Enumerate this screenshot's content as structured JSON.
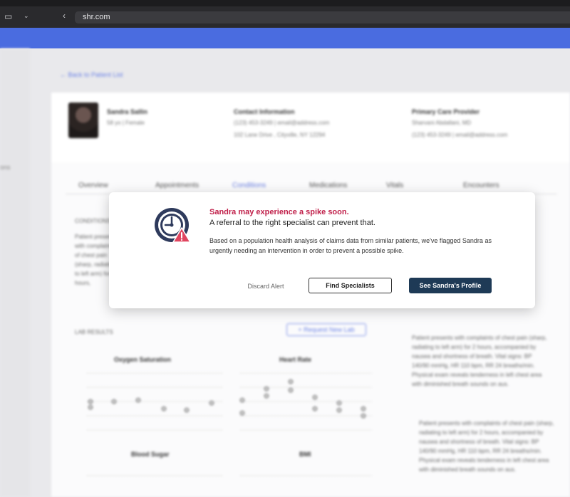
{
  "browser": {
    "url": "shr.com"
  },
  "background": {
    "side_label": "ons",
    "back_link": "Back to Patient List",
    "patient": {
      "name": "Sandra Sallin",
      "meta": "58 yo | Female"
    },
    "contact": {
      "title": "Contact Information",
      "line1": "(123) 453-3249 | email@address.com",
      "line2": "102 Lane Drive , Cityville, NY 12294"
    },
    "pcp": {
      "title": "Primary Care Provider",
      "line1": "Sharvani Abdallani, MD",
      "line2": "(123) 453-3249 | email@address.com"
    },
    "tabs": [
      "Overview",
      "Appointments",
      "Conditions",
      "Medications",
      "Vitals",
      "Encounters"
    ],
    "conditions_label": "CONDITIONS",
    "lab_results_label": "LAB RESULTS",
    "request_lab": "+ Request New Lab",
    "charts": [
      "Oxygen Saturation",
      "Heart Rate",
      "Blood Sugar",
      "BMI"
    ],
    "note": "Patient presents with complaints of chest pain (sharp, radiating to left arm) for 2 hours, accompanied by nausea and shortness of breath. Vital signs: BP 140/90 mmHg, HR 110 bpm, RR 24 breaths/min. Physical exam reveals tenderness in left chest area with diminished breath sounds on aus."
  },
  "modal": {
    "headline": "Sandra may experience a spike soon.",
    "subline": "A referral to the right specialist can prevent that.",
    "body": "Based on a population health analysis of claims data from similar patients, we've flagged Sandra as urgently needing an intervention in order to prevent a possible spike.",
    "discard": "Discard Alert",
    "find": "Find Specialists",
    "see_profile": "See Sandra's Profile",
    "accent": "#c0204a",
    "primary": "#1e3a56"
  }
}
